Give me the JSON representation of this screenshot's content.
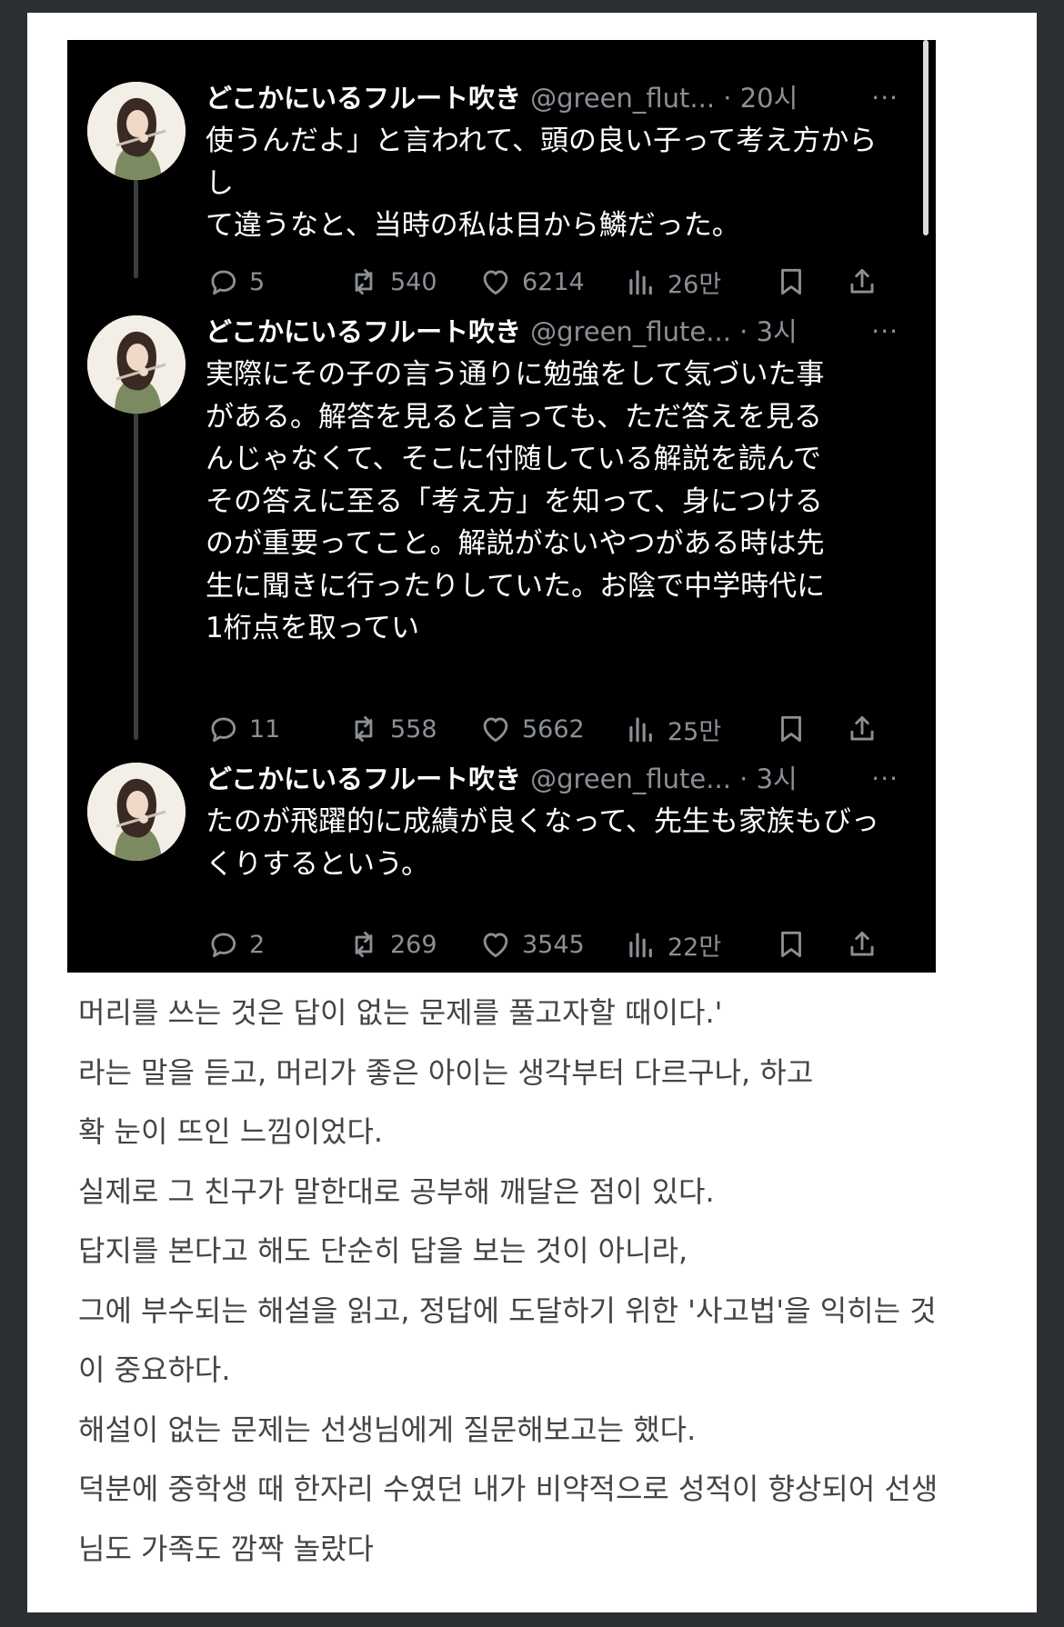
{
  "tweets": [
    {
      "name": "どこかにいるフルート吹き",
      "handle": "@green_flut...",
      "separator": "·",
      "time": "20시",
      "more": "···",
      "text": "使うんだよ」と言われて、頭の良い子って考え方からし\nて違うなと、当時の私は目から鱗だった。",
      "replies": "5",
      "retweets": "540",
      "likes": "6214",
      "views": "26만"
    },
    {
      "name": "どこかにいるフルート吹き",
      "handle": "@green_flute...",
      "separator": "·",
      "time": "3시",
      "more": "···",
      "text": "実際にその子の言う通りに勉強をして気づいた事\nがある。解答を見ると言っても、ただ答えを見る\nんじゃなくて、そこに付随している解説を読んで\nその答えに至る「考え方」を知って、身につける\nのが重要ってこと。解説がないやつがある時は先\n生に聞きに行ったりしていた。お陰で中学時代に\n1桁点を取ってい",
      "replies": "11",
      "retweets": "558",
      "likes": "5662",
      "views": "25만"
    },
    {
      "name": "どこかにいるフルート吹き",
      "handle": "@green_flute...",
      "separator": "·",
      "time": "3시",
      "more": "···",
      "text": "たのが飛躍的に成績が良くなって、先生も家族もびっ\nくりするという。",
      "replies": "2",
      "retweets": "269",
      "likes": "3545",
      "views": "22만"
    }
  ],
  "translation": [
    "머리를 쓰는 것은 답이 없는 문제를 풀고자할 때이다.'",
    "라는 말을 듣고, 머리가 좋은 아이는 생각부터 다르구나, 하고",
    "확 눈이 뜨인 느낌이었다.",
    "실제로 그 친구가 말한대로 공부해 깨달은 점이 있다.",
    "답지를 본다고 해도 단순히 답을 보는 것이 아니라,",
    "그에 부수되는 해설을 읽고, 정답에 도달하기 위한 '사고법'을 익히는 것",
    "이 중요하다.",
    "해설이 없는 문제는 선생님에게 질문해보고는 했다.",
    "덕분에 중학생 때 한자리 수였던 내가 비약적으로 성적이 향상되어 선생",
    "님도 가족도 깜짝 놀랐다"
  ],
  "colors": {
    "page_bg": "#2b2e33",
    "card_bg": "#ffffff",
    "tweet_bg": "#000000",
    "tweet_text": "#ffffff",
    "muted": "#8b9096",
    "korean_text": "#444444"
  },
  "icons": [
    "reply-icon",
    "retweet-icon",
    "like-icon",
    "views-icon",
    "bookmark-icon",
    "share-icon",
    "more-icon"
  ]
}
